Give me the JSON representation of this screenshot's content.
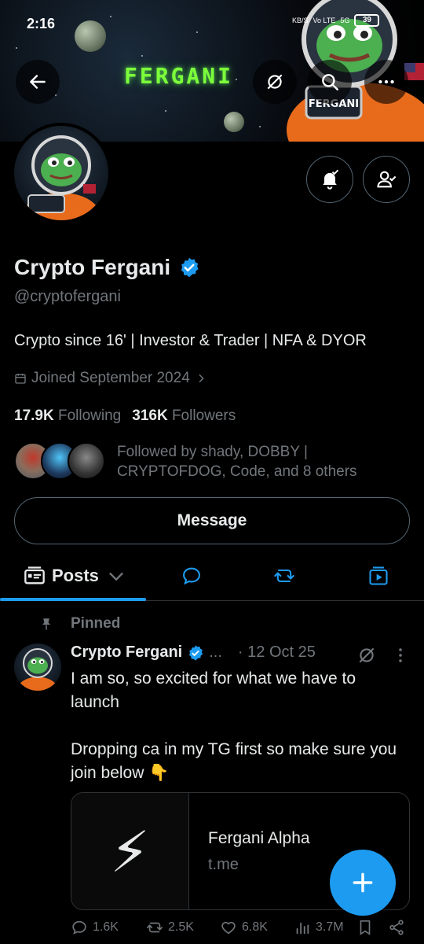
{
  "status_bar": {
    "time": "2:16",
    "network_speed": "KB/S",
    "network_label": "Vo LTE",
    "network_type": "5G",
    "battery": "39"
  },
  "banner": {
    "title": "FERGANI",
    "badge": "FERGANI"
  },
  "profile": {
    "name": "Crypto Fergani",
    "handle": "@cryptofergani",
    "bio": "Crypto since 16' | Investor & Trader | NFA & DYOR",
    "joined": "Joined September 2024",
    "following_count": "17.9K",
    "following_label": "Following",
    "followers_count": "316K",
    "followers_label": "Followers",
    "followed_by": "Followed by shady, DOBBY | CRYPTOFDOG, Code, and 8 others"
  },
  "buttons": {
    "message": "Message"
  },
  "tabs": {
    "posts": "Posts"
  },
  "post": {
    "pinned_label": "Pinned",
    "author": "Crypto Fergani",
    "ellipsis": "...",
    "date": "· 12 Oct 25",
    "text": "I am so, so excited for what we have to launch\n\nDropping ca in my TG first so make sure you join below 👇",
    "card": {
      "title": "Fergani Alpha",
      "domain": "t.me",
      "icon": "⚡"
    },
    "stats": {
      "replies": "1.6K",
      "reposts": "2.5K",
      "likes": "6.8K",
      "views": "3.7M"
    }
  },
  "colors": {
    "accent": "#1d9bf0",
    "background": "#000000",
    "muted": "#71767b",
    "text": "#e7e9ea"
  }
}
